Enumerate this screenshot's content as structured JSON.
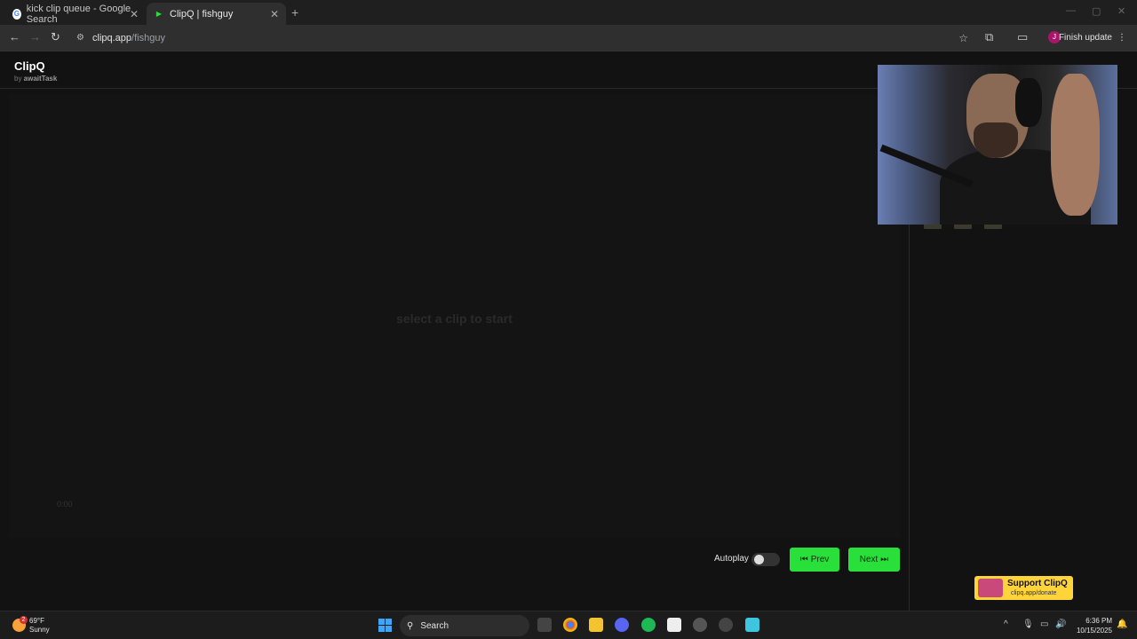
{
  "browser": {
    "tabs": [
      {
        "title": "kick clip queue - Google Search",
        "favicon": "google-icon"
      },
      {
        "title": "ClipQ | fishguy",
        "favicon": "play-icon"
      }
    ],
    "url_host": "clipq.app",
    "url_path": "/fishguy",
    "profile_initial": "J",
    "update_label": "Finish update"
  },
  "app": {
    "name": "ClipQ",
    "byline_prefix": "by ",
    "byline_author": "awaitTask",
    "placeholder": "select a clip to start",
    "time": "0:00",
    "autoplay_label": "Autoplay",
    "prev_label": "Prev",
    "next_label": "Next",
    "support_title": "Support ClipQ",
    "support_url": "clipq.app/donate"
  },
  "taskbar": {
    "temperature": "69°F",
    "condition": "Sunny",
    "weather_badge": "2",
    "search_label": "Search",
    "time": "6:36 PM",
    "date": "10/15/2025"
  }
}
